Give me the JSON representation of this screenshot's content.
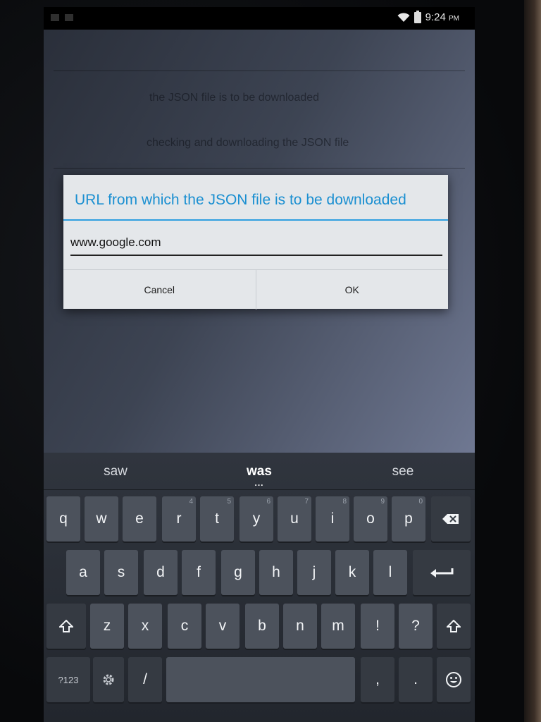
{
  "status_bar": {
    "time": "9:24",
    "time_suffix": "PM",
    "icons": [
      "wifi-icon",
      "battery-icon"
    ]
  },
  "background_prefs": {
    "item1": "the JSON file is to be downloaded",
    "item2": "checking and downloading the JSON file"
  },
  "dialog": {
    "title": "URL from which the JSON file is to be downloaded",
    "input_value": "www.google.com",
    "cancel_label": "Cancel",
    "ok_label": "OK"
  },
  "keyboard": {
    "suggestions": [
      "saw",
      "was",
      "see"
    ],
    "row1": [
      {
        "label": "q",
        "sup": ""
      },
      {
        "label": "w",
        "sup": ""
      },
      {
        "label": "e",
        "sup": ""
      },
      {
        "label": "r",
        "sup": "4"
      },
      {
        "label": "t",
        "sup": "5"
      },
      {
        "label": "y",
        "sup": "6"
      },
      {
        "label": "u",
        "sup": "7"
      },
      {
        "label": "i",
        "sup": "8"
      },
      {
        "label": "o",
        "sup": "9"
      },
      {
        "label": "p",
        "sup": "0"
      }
    ],
    "row2": [
      "a",
      "s",
      "d",
      "f",
      "g",
      "h",
      "j",
      "k",
      "l"
    ],
    "row3": [
      "z",
      "x",
      "c",
      "v",
      "b",
      "n",
      "m",
      "!",
      "?"
    ],
    "row4": {
      "symbols_label": "?123",
      "slash_label": "/",
      "comma_label": ",",
      "period_label": "."
    },
    "icons": {
      "backspace": "backspace-icon",
      "enter": "enter-icon",
      "shift": "shift-icon",
      "settings": "settings-icon",
      "emoji": "emoji-icon"
    }
  },
  "colors": {
    "dialog_accent": "#1a8fd1",
    "key_bg": "#4c525c"
  }
}
